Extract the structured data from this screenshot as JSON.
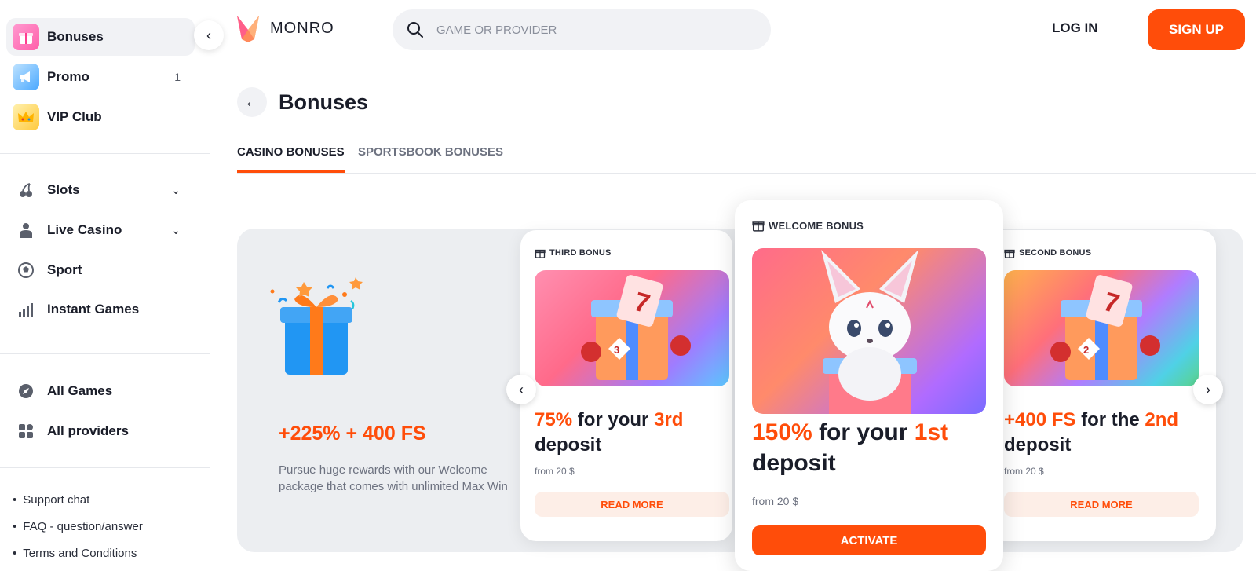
{
  "sidebar": {
    "top_items": [
      {
        "label": "Bonuses",
        "icon": "gift-icon",
        "count": ""
      },
      {
        "label": "Promo",
        "icon": "megaphone-icon",
        "count": "1"
      },
      {
        "label": "VIP Club",
        "icon": "crown-icon",
        "count": ""
      }
    ],
    "game_items": [
      {
        "label": "Slots",
        "icon": "cherry-icon"
      },
      {
        "label": "Live Casino",
        "icon": "dealer-icon"
      },
      {
        "label": "Sport",
        "icon": "soccer-ball-icon"
      },
      {
        "label": "Instant Games",
        "icon": "bar-chart-icon"
      }
    ],
    "all_items": [
      {
        "label": "All Games",
        "icon": "compass-icon"
      },
      {
        "label": "All providers",
        "icon": "grid-icon"
      }
    ],
    "footer_links": [
      "Support chat",
      "FAQ - question/answer",
      "Terms and Conditions"
    ]
  },
  "header": {
    "logo_text": "MONRO",
    "search_placeholder": "GAME OR PROVIDER",
    "login_label": "LOG IN",
    "signup_label": "SIGN UP"
  },
  "page": {
    "title": "Bonuses",
    "tabs": [
      "CASINO BONUSES",
      "SPORTSBOOK BONUSES"
    ]
  },
  "promo": {
    "headline": "+225% + 400 FS",
    "description": "Pursue huge rewards with our Welcome package that comes with unlimited Max Win"
  },
  "cards": {
    "third": {
      "tag": "THIRD BONUS",
      "title_hl1": "75%",
      "title_mid": " for your ",
      "title_hl2": "3rd",
      "title_end": " deposit",
      "from": "from 20 $",
      "button": "READ MORE",
      "badge_number": "3"
    },
    "welcome": {
      "tag": "WELCOME BONUS",
      "title_hl1": "150%",
      "title_mid": " for your ",
      "title_hl2": "1st",
      "title_end": " deposit",
      "from": "from  20 $",
      "button": "ACTIVATE"
    },
    "second": {
      "tag": "SECOND BONUS",
      "title_hl1": "+400 FS",
      "title_mid": " for the ",
      "title_hl2": "2nd",
      "title_end": " deposit",
      "from": "from 20 $",
      "button": "READ MORE",
      "badge_number": "2"
    }
  },
  "colors": {
    "accent": "#ff4d0a",
    "accent_soft": "#fdeee7",
    "panel_bg": "#eceef1",
    "text": "#1a1d29"
  }
}
